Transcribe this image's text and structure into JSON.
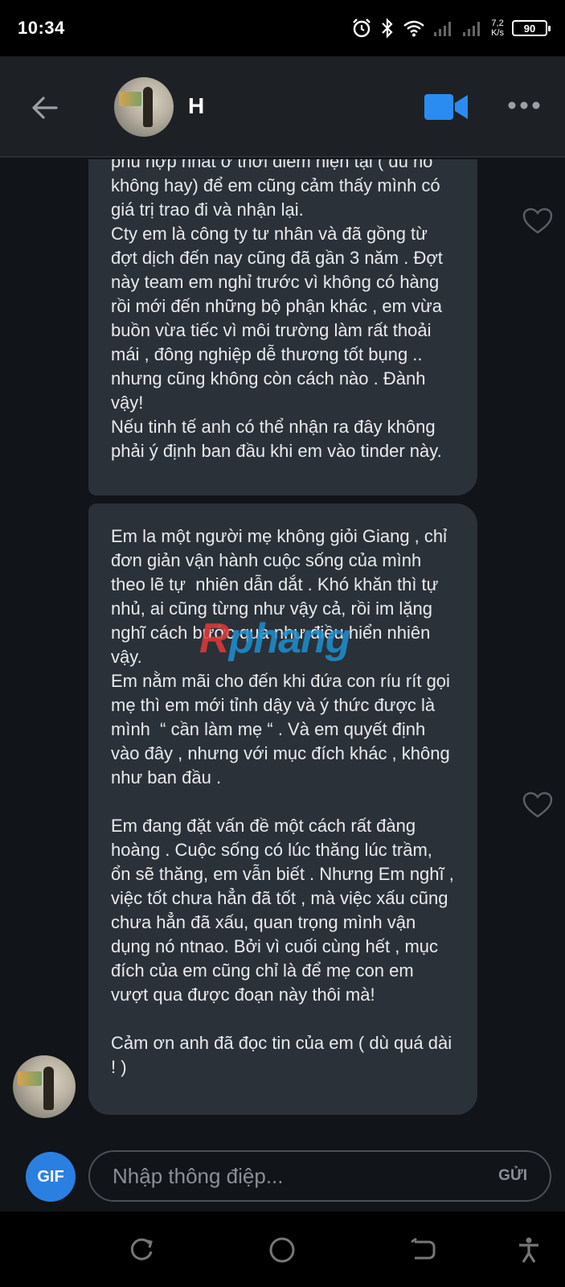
{
  "status_bar": {
    "time": "10:34",
    "speed_value": "7,2",
    "speed_unit": "K/s",
    "battery": "90"
  },
  "header": {
    "contact_name": "H",
    "back_icon": "arrow-left-icon",
    "video_icon": "video-camera-icon",
    "more_icon": "more-dots-icon",
    "video_color": "#2a8cf0"
  },
  "messages": [
    {
      "text": "phù hợp nhất ở thời điểm hiện tại ( dù nó không hay) để em cũng cảm thấy mình có giá trị trao đi và nhận lại.\nCty em là công ty tư nhân và đã gồng từ đợt dịch đến nay cũng đã gần 3 năm . Đợt này team em nghỉ trước vì không có hàng rồi mới đến những bộ phận khác , em vừa buồn vừa tiếc vì môi trường làm rất thoải mái , đông nghiệp dễ thương tốt bụng .. nhưng cũng không còn cách nào . Đành vậy!\nNếu tinh tế anh có thể nhận ra đây không phải ý định ban đầu khi em vào tinder này."
    },
    {
      "text": "Em la một người mẹ không giỏi Giang , chỉ đơn giản vận hành cuộc sống của mình theo lẽ tự  nhiên dẫn dắt . Khó khăn thì tự nhủ, ai cũng từng như vậy cả, rồi im lặng nghĩ cách bước qua như điều hiển nhiên vậy.\nEm nằm mãi cho đến khi đứa con ríu rít gọi mẹ thì em mới tỉnh dậy và ý thức được là mình  “ cần làm mẹ “ . Và em quyết định vào đây , nhưng với mục đích khác , không như ban đầu .\n\nEm đang đặt vấn đề một cách rất đàng hoàng . Cuộc sống có lúc thăng lúc trầm, ổn sẽ thăng, em vẫn biết . Nhưng Em nghĩ , việc tốt chưa hẳn đã tốt , mà việc xấu cũng  chưa hẳn đã xấu, quan trọng mình vận dụng nó ntnao. Bởi vì cuối cùng hết , mục đích của em cũng chỉ là để mẹ con em vượt qua được đoạn này thôi mà!\n\nCảm ơn anh đã đọc tin của em ( dù quá dài ! )"
    }
  ],
  "watermark": {
    "first": "R",
    "rest": "phang"
  },
  "composer": {
    "gif_label": "GIF",
    "placeholder": "Nhập thông điệp...",
    "send_label": "GỬI",
    "gif_color": "#2a7fe0"
  },
  "nav_bar": {
    "icons": [
      "recent-apps-icon",
      "home-icon",
      "back-icon",
      "accessibility-icon"
    ]
  }
}
